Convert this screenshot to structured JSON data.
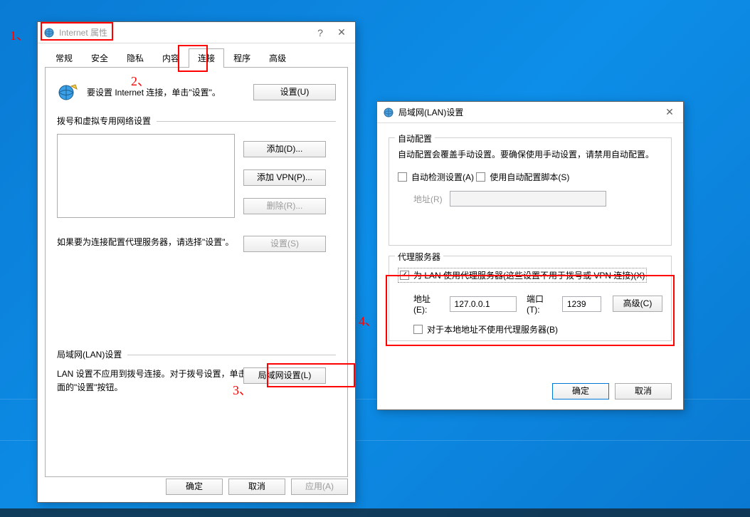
{
  "wallpaper": {
    "accent": "#0a7bd4"
  },
  "inet": {
    "title": "Internet 属性",
    "tabs": [
      "常规",
      "安全",
      "隐私",
      "内容",
      "连接",
      "程序",
      "高级"
    ],
    "active_tab_index": 4,
    "setup_text": "要设置 Internet 连接，单击\"设置\"。",
    "btn_setup": "设置(U)",
    "section_dialup": "拨号和虚拟专用网络设置",
    "btn_add": "添加(D)...",
    "btn_add_vpn": "添加 VPN(P)...",
    "btn_remove": "删除(R)...",
    "btn_settings": "设置(S)",
    "proxy_hint": "如果要为连接配置代理服务器，请选择\"设置\"。",
    "section_lan": "局域网(LAN)设置",
    "lan_hint": "LAN 设置不应用到拨号连接。对于拨号设置，单击上面的\"设置\"按钮。",
    "btn_lan": "局域网设置(L)",
    "ok": "确定",
    "cancel": "取消",
    "apply": "应用(A)"
  },
  "lan": {
    "title": "局域网(LAN)设置",
    "group_auto": "自动配置",
    "auto_text": "自动配置会覆盖手动设置。要确保使用手动设置，请禁用自动配置。",
    "chk_auto_detect": "自动检测设置(A)",
    "chk_auto_detect_checked": false,
    "chk_use_script": "使用自动配置脚本(S)",
    "chk_use_script_checked": false,
    "lbl_script_addr": "地址(R)",
    "script_addr_value": "",
    "group_proxy": "代理服务器",
    "chk_use_proxy": "为 LAN 使用代理服务器(这些设置不用于拨号或 VPN 连接)(X)",
    "chk_use_proxy_checked": true,
    "lbl_addr": "地址(E):",
    "addr_value": "127.0.0.1",
    "lbl_port": "端口(T):",
    "port_value": "1239",
    "btn_advanced": "高级(C)",
    "chk_bypass_local": "对于本地地址不使用代理服务器(B)",
    "chk_bypass_local_checked": false,
    "ok": "确定",
    "cancel": "取消"
  },
  "annotations": {
    "a1": "1、",
    "a2": "2、",
    "a3": "3、",
    "a4": "4、"
  }
}
